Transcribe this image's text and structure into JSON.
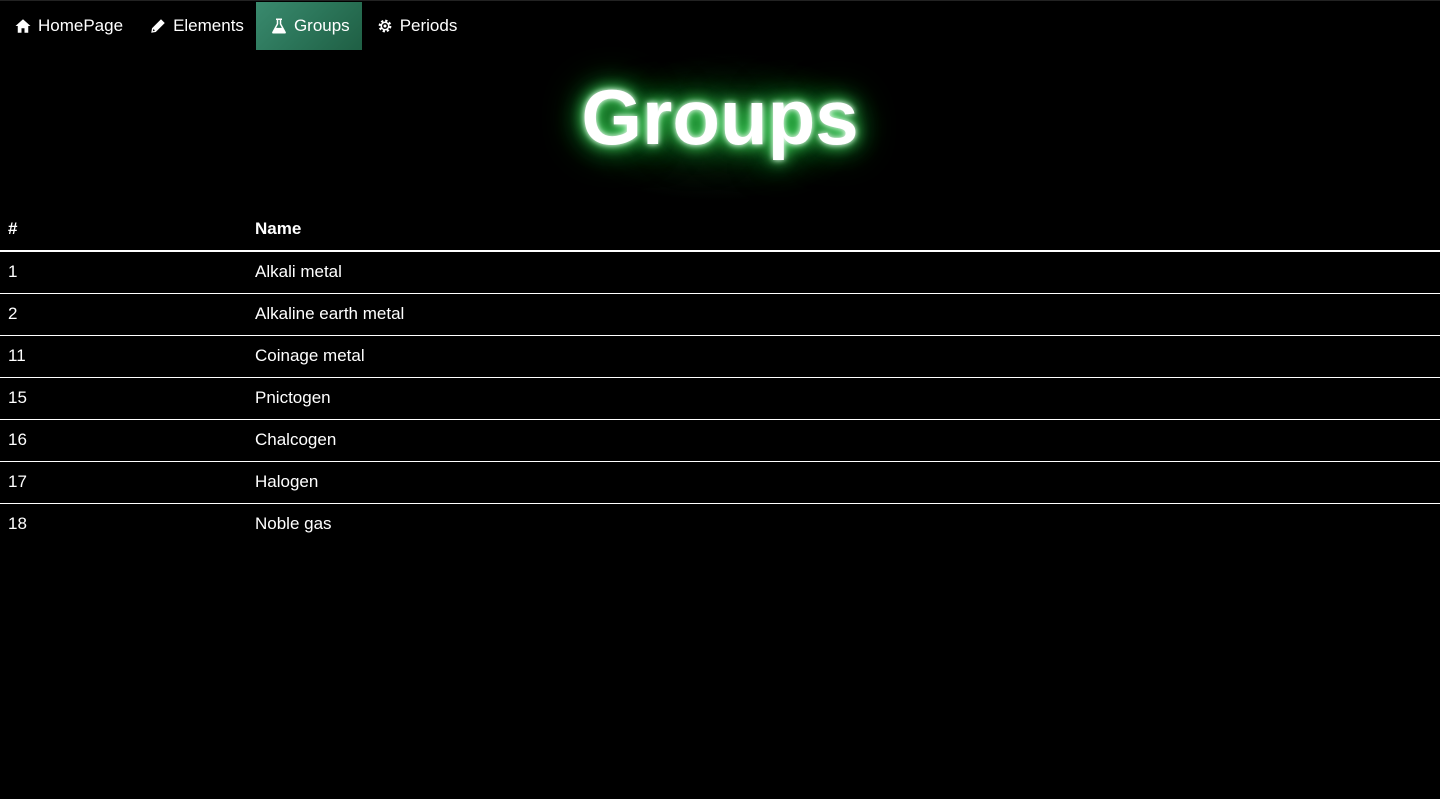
{
  "nav": {
    "items": [
      {
        "label": "HomePage",
        "icon": "home-icon",
        "active": false
      },
      {
        "label": "Elements",
        "icon": "pencil-icon",
        "active": false
      },
      {
        "label": "Groups",
        "icon": "flask-icon",
        "active": true
      },
      {
        "label": "Periods",
        "icon": "gear-icon",
        "active": false
      }
    ],
    "active_color": "#2b7559"
  },
  "page": {
    "title": "Groups",
    "glow_color": "#1fcf3e"
  },
  "table": {
    "headers": [
      "#",
      "Name"
    ],
    "rows": [
      {
        "num": "1",
        "name": "Alkali metal"
      },
      {
        "num": "2",
        "name": "Alkaline earth metal"
      },
      {
        "num": "11",
        "name": "Coinage metal"
      },
      {
        "num": "15",
        "name": "Pnictogen"
      },
      {
        "num": "16",
        "name": "Chalcogen"
      },
      {
        "num": "17",
        "name": "Halogen"
      },
      {
        "num": "18",
        "name": "Noble gas"
      }
    ]
  }
}
